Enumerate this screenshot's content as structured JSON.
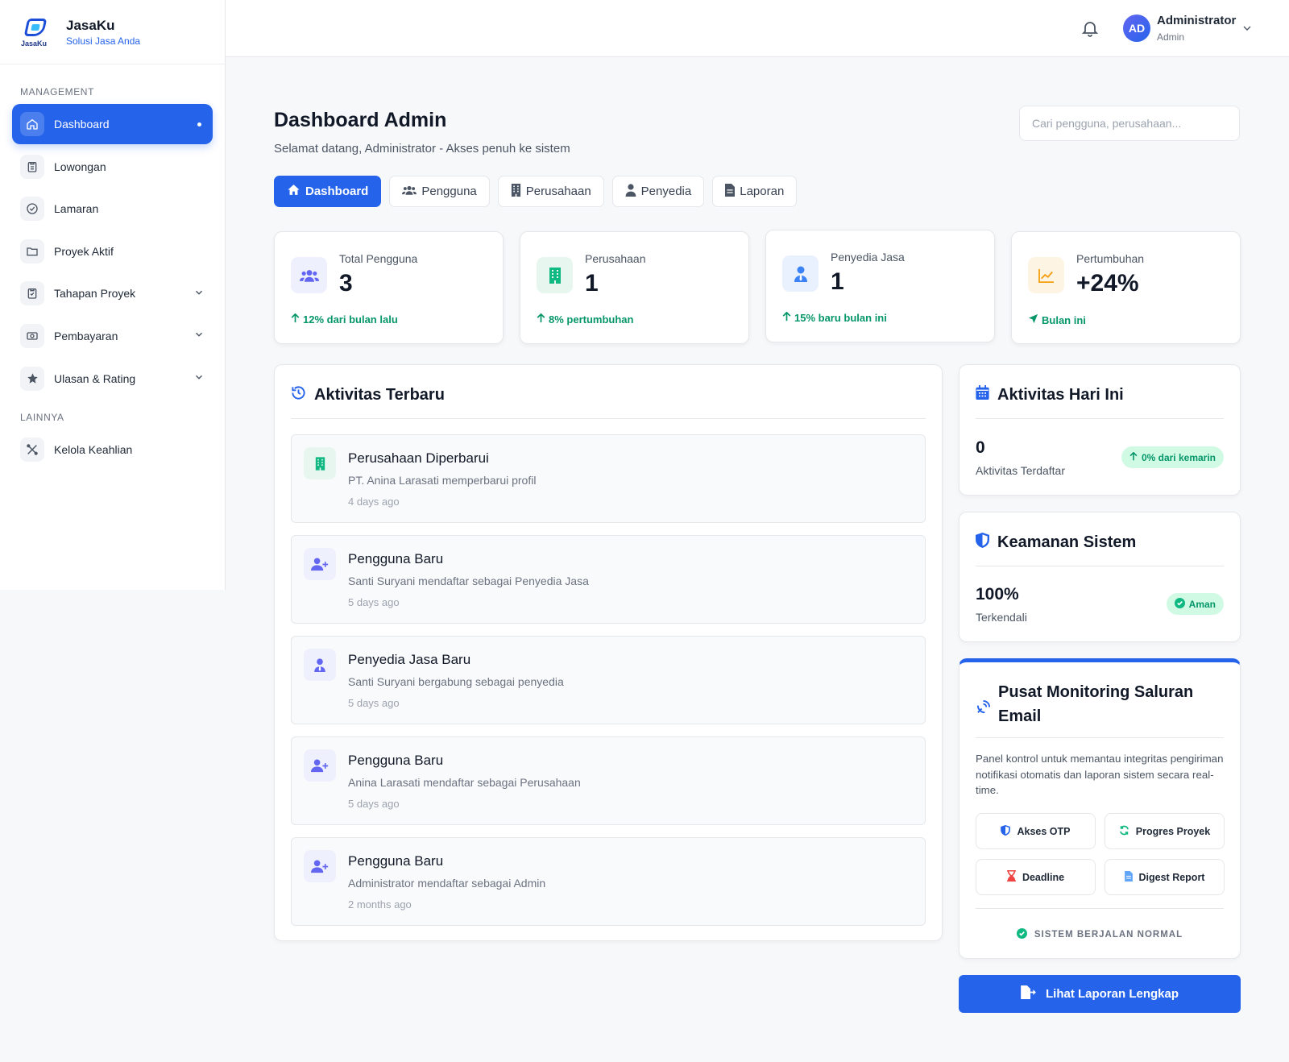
{
  "brand": {
    "logo_text": "JasaKu",
    "name": "JasaKu",
    "tagline": "Solusi Jasa Anda"
  },
  "sidebar": {
    "section_management": "MANAGEMENT",
    "section_other": "LAINNYA",
    "items": [
      {
        "label": "Dashboard",
        "icon": "home-icon",
        "active": true
      },
      {
        "label": "Lowongan",
        "icon": "clipboard-icon"
      },
      {
        "label": "Lamaran",
        "icon": "check-circle-icon"
      },
      {
        "label": "Proyek Aktif",
        "icon": "folder-icon"
      },
      {
        "label": "Tahapan Proyek",
        "icon": "clipboard-list-icon",
        "expandable": true
      },
      {
        "label": "Pembayaran",
        "icon": "payment-icon",
        "expandable": true
      },
      {
        "label": "Ulasan & Rating",
        "icon": "star-icon",
        "expandable": true
      }
    ],
    "other_items": [
      {
        "label": "Kelola Keahlian",
        "icon": "tools-icon"
      }
    ]
  },
  "topbar": {
    "avatar_initials": "AD",
    "user_name": "Administrator",
    "user_role": "Admin"
  },
  "header": {
    "title": "Dashboard Admin",
    "subtitle": "Selamat datang, Administrator - Akses penuh ke sistem",
    "search_placeholder": "Cari pengguna, perusahaan..."
  },
  "tabs": [
    {
      "label": "Dashboard",
      "icon": "home-icon",
      "active": true
    },
    {
      "label": "Pengguna",
      "icon": "users-icon"
    },
    {
      "label": "Perusahaan",
      "icon": "building-icon"
    },
    {
      "label": "Penyedia",
      "icon": "user-tie-icon"
    },
    {
      "label": "Laporan",
      "icon": "file-icon"
    }
  ],
  "stats": [
    {
      "label": "Total Pengguna",
      "value": "3",
      "trend": "12% dari bulan lalu",
      "icon": "users-icon",
      "color": "#6366f1"
    },
    {
      "label": "Perusahaan",
      "value": "1",
      "trend": "8% pertumbuhan",
      "icon": "building-icon",
      "color": "#10b981"
    },
    {
      "label": "Penyedia Jasa",
      "value": "1",
      "trend": "15% baru bulan ini",
      "icon": "user-tie-icon",
      "color": "#3b82f6"
    },
    {
      "label": "Pertumbuhan",
      "value": "+24%",
      "trend": "Bulan ini",
      "icon": "chart-line-icon",
      "color": "#f59e0b"
    }
  ],
  "activity": {
    "title": "Aktivitas Terbaru",
    "items": [
      {
        "title": "Perusahaan Diperbarui",
        "desc": "PT. Anina Larasati memperbarui profil",
        "time": "4 days ago",
        "icon": "building-icon"
      },
      {
        "title": "Pengguna Baru",
        "desc": "Santi Suryani mendaftar sebagai Penyedia Jasa",
        "time": "5 days ago",
        "icon": "user-plus-icon"
      },
      {
        "title": "Penyedia Jasa Baru",
        "desc": "Santi Suryani bergabung sebagai penyedia",
        "time": "5 days ago",
        "icon": "user-tie-icon"
      },
      {
        "title": "Pengguna Baru",
        "desc": "Anina Larasati mendaftar sebagai Perusahaan",
        "time": "5 days ago",
        "icon": "user-plus-icon"
      },
      {
        "title": "Pengguna Baru",
        "desc": "Administrator mendaftar sebagai Admin",
        "time": "2 months ago",
        "icon": "user-plus-icon"
      }
    ]
  },
  "today": {
    "title": "Aktivitas Hari Ini",
    "value": "0",
    "label": "Aktivitas Terdaftar",
    "badge": "0% dari kemarin"
  },
  "security": {
    "title": "Keamanan Sistem",
    "value": "100%",
    "label": "Terkendali",
    "badge": "Aman"
  },
  "monitoring": {
    "title_line1": "Pusat Monitoring Saluran",
    "title_line2": "Email",
    "description": "Panel kontrol untuk memantau integritas pengiriman notifikasi otomatis dan laporan sistem secara real-time.",
    "buttons": [
      {
        "label": "Akses OTP",
        "icon": "shield-icon"
      },
      {
        "label": "Progres Proyek",
        "icon": "sync-icon"
      },
      {
        "label": "Deadline",
        "icon": "hourglass-icon"
      },
      {
        "label": "Digest Report",
        "icon": "document-icon"
      }
    ],
    "status": "SISTEM BERJALAN NORMAL"
  },
  "cta": {
    "label": "Lihat Laporan Lengkap"
  },
  "colors": {
    "primary": "#2563eb",
    "success": "#059669",
    "danger": "#ef4444"
  }
}
